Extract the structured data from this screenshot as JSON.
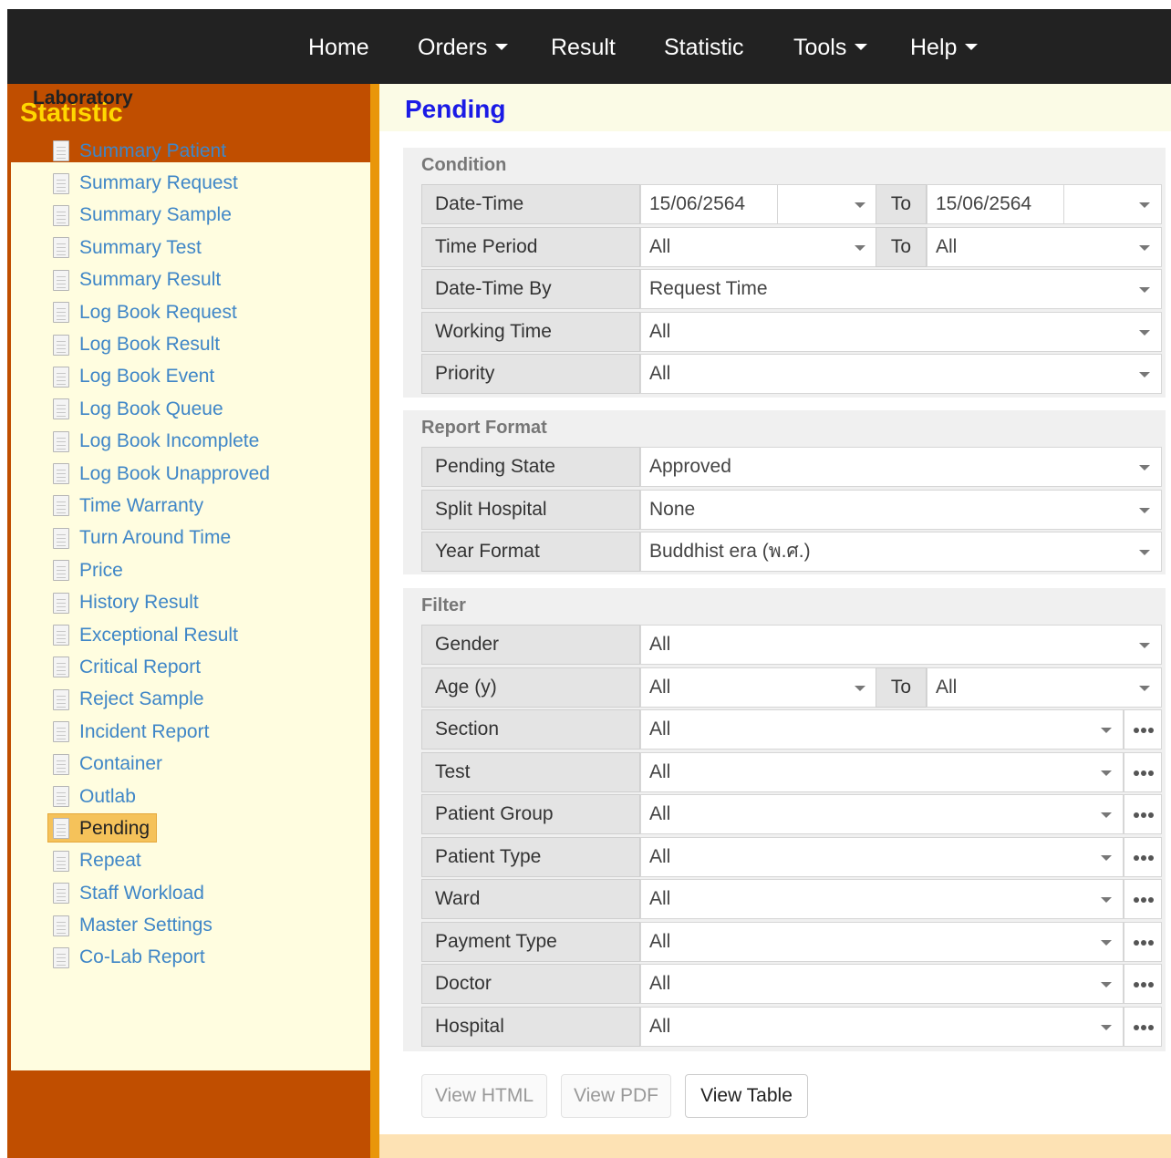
{
  "nav": {
    "home": "Home",
    "orders": "Orders",
    "result": "Result",
    "statistic": "Statistic",
    "tools": "Tools",
    "help": "Help"
  },
  "sidebar": {
    "title": "Statistic",
    "heading": "Laboratory",
    "items": [
      {
        "label": "Summary Patient"
      },
      {
        "label": "Summary Request"
      },
      {
        "label": "Summary Sample"
      },
      {
        "label": "Summary Test"
      },
      {
        "label": "Summary Result"
      },
      {
        "label": "Log Book Request"
      },
      {
        "label": "Log Book Result"
      },
      {
        "label": "Log Book Event"
      },
      {
        "label": "Log Book Queue"
      },
      {
        "label": "Log Book Incomplete"
      },
      {
        "label": "Log Book Unapproved"
      },
      {
        "label": "Time Warranty"
      },
      {
        "label": "Turn Around Time"
      },
      {
        "label": "Price"
      },
      {
        "label": "History Result"
      },
      {
        "label": "Exceptional Result"
      },
      {
        "label": "Critical Report"
      },
      {
        "label": "Reject Sample"
      },
      {
        "label": "Incident Report"
      },
      {
        "label": "Container"
      },
      {
        "label": "Outlab"
      },
      {
        "label": "Pending",
        "active": true
      },
      {
        "label": "Repeat"
      },
      {
        "label": "Staff Workload"
      },
      {
        "label": "Master Settings"
      },
      {
        "label": "Co-Lab Report"
      }
    ]
  },
  "page": {
    "title": "Pending"
  },
  "to_label": "To",
  "condition": {
    "title": "Condition",
    "date_time": {
      "label": "Date-Time",
      "from": "15/06/2564",
      "from_time": "",
      "to": "15/06/2564",
      "to_time": ""
    },
    "time_period": {
      "label": "Time Period",
      "from": "All",
      "to": "All"
    },
    "date_time_by": {
      "label": "Date-Time By",
      "value": "Request Time"
    },
    "working_time": {
      "label": "Working Time",
      "value": "All"
    },
    "priority": {
      "label": "Priority",
      "value": "All"
    }
  },
  "report_format": {
    "title": "Report Format",
    "pending_state": {
      "label": "Pending State",
      "value": "Approved"
    },
    "split_hospital": {
      "label": "Split Hospital",
      "value": "None"
    },
    "year_format": {
      "label": "Year Format",
      "value": "Buddhist era (พ.ศ.)"
    }
  },
  "filter": {
    "title": "Filter",
    "gender": {
      "label": "Gender",
      "value": "All"
    },
    "age": {
      "label": "Age (y)",
      "from": "All",
      "to": "All"
    },
    "section": {
      "label": "Section",
      "value": "All"
    },
    "test": {
      "label": "Test",
      "value": "All"
    },
    "patient_group": {
      "label": "Patient Group",
      "value": "All"
    },
    "patient_type": {
      "label": "Patient Type",
      "value": "All"
    },
    "ward": {
      "label": "Ward",
      "value": "All"
    },
    "payment_type": {
      "label": "Payment Type",
      "value": "All"
    },
    "doctor": {
      "label": "Doctor",
      "value": "All"
    },
    "hospital": {
      "label": "Hospital",
      "value": "All"
    }
  },
  "buttons": {
    "view_html": "View HTML",
    "view_pdf": "View PDF",
    "view_table": "View Table"
  },
  "colors": {
    "topbar": "#222222",
    "sidebar_bg": "#c04e00",
    "sidebar_title": "#ffd700",
    "sidebar_panel": "#fffde0",
    "link": "#3f86c7",
    "page_title": "#1a1ae6",
    "active_highlight": "#f5c25a"
  }
}
